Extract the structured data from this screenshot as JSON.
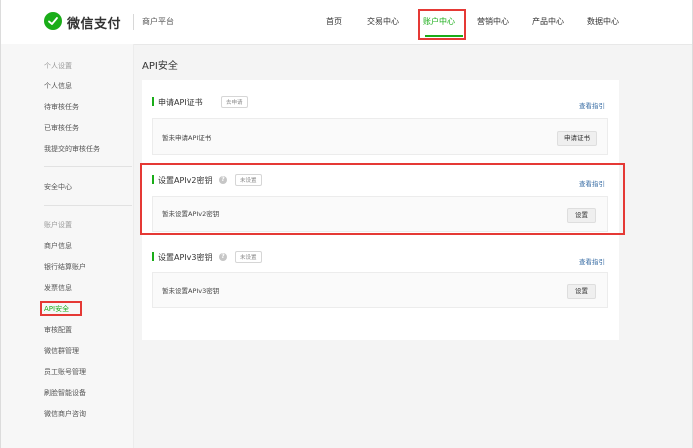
{
  "header": {
    "brand": "微信支付",
    "subtitle": "商户平台",
    "nav": [
      "首页",
      "交易中心",
      "账户中心",
      "营销中心",
      "产品中心",
      "数据中心"
    ],
    "active_nav": "账户中心"
  },
  "sidebar": {
    "group_personal": "个人设置",
    "personal_items": [
      "个人信息",
      "待审核任务",
      "已审核任务",
      "我提交的审核任务"
    ],
    "security_center": "安全中心",
    "group_account": "账户设置",
    "account_items": [
      "商户信息",
      "银行结算账户",
      "发票信息",
      "API安全",
      "审核配置",
      "微信群管理",
      "员工账号管理",
      "刷脸智能设备",
      "微信商户咨询"
    ],
    "active_item": "API安全"
  },
  "main": {
    "title": "API安全",
    "sections": [
      {
        "title": "申请API证书",
        "badge": "去申请",
        "has_help_icon": false,
        "guide": "查看指引",
        "card_text": "暂未申请API证书",
        "button": "申请证书"
      },
      {
        "title": "设置APIv2密钥",
        "badge": "未设置",
        "has_help_icon": true,
        "guide": "查看指引",
        "card_text": "暂未设置APIv2密钥",
        "button": "设置"
      },
      {
        "title": "设置APIv3密钥",
        "badge": "未设置",
        "has_help_icon": true,
        "guide": "查看指引",
        "card_text": "暂未设置APIv3密钥",
        "button": "设置"
      }
    ]
  },
  "colors": {
    "accent": "#1aad19",
    "highlight": "#e53935",
    "link": "#3a6ea5"
  }
}
